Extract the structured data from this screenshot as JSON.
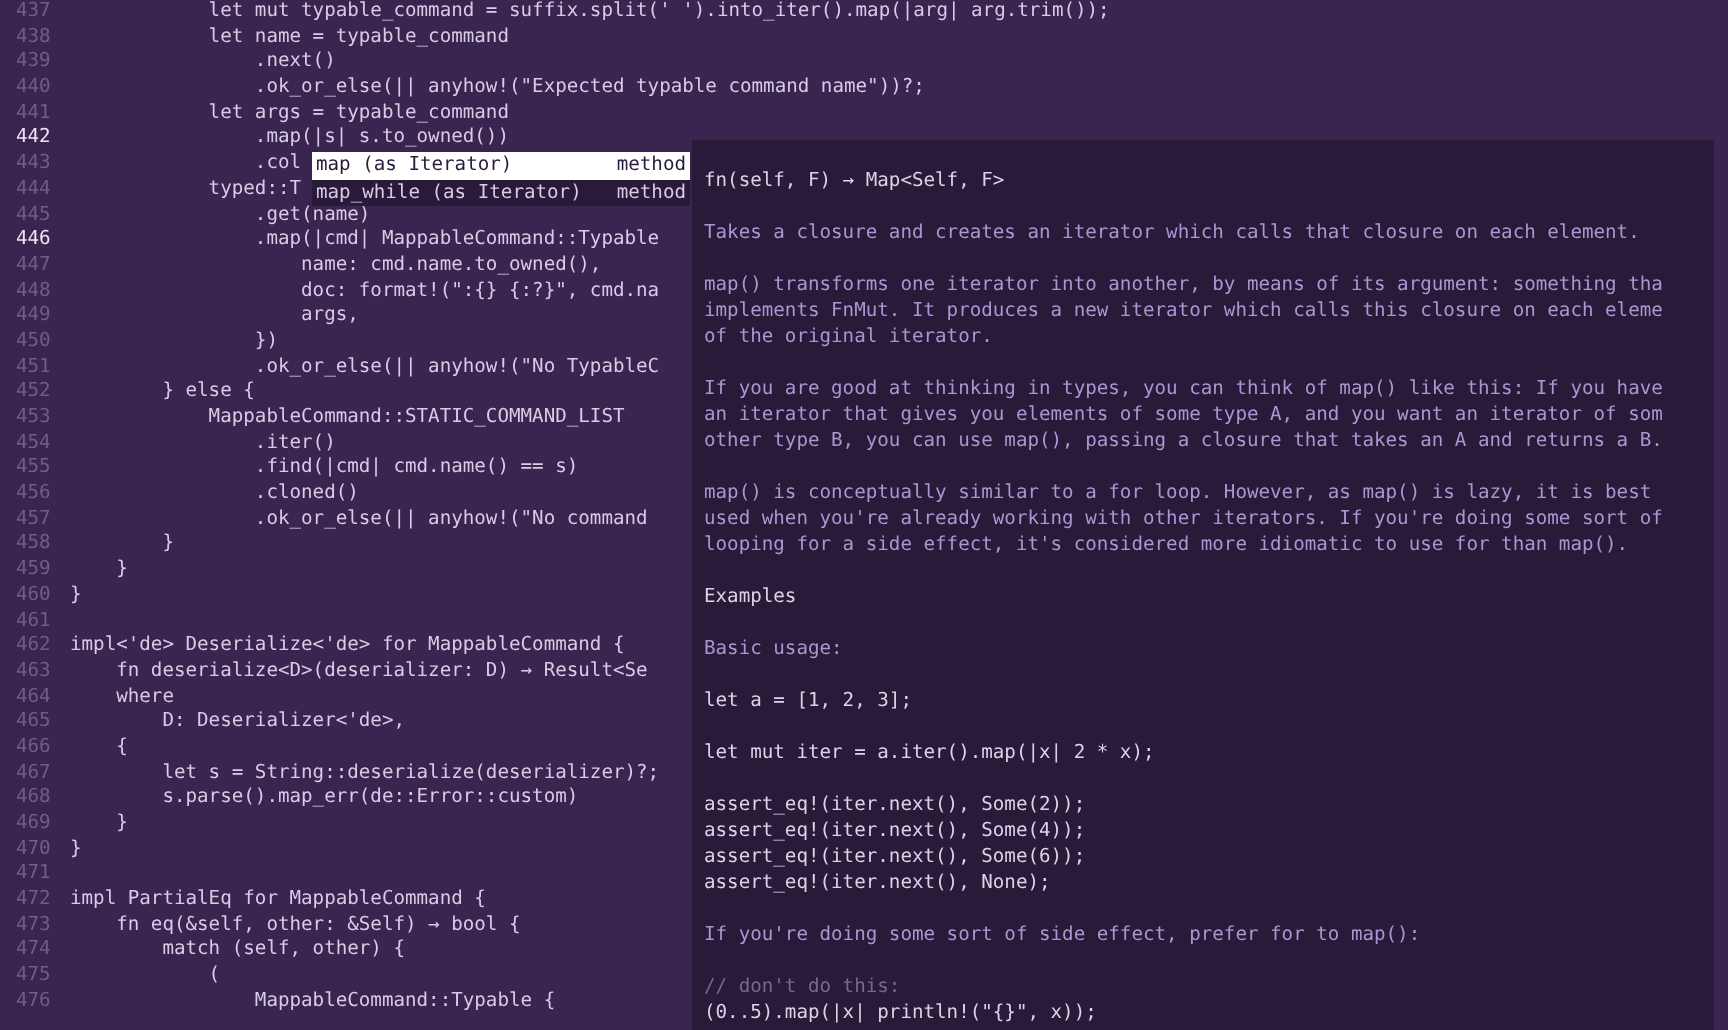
{
  "editor": {
    "lines": [
      {
        "number": "437",
        "code": "            let mut typable_command = suffix.split(' ').into_iter().map(|arg| arg.trim());",
        "current": false
      },
      {
        "number": "438",
        "code": "            let name = typable_command",
        "current": false
      },
      {
        "number": "439",
        "code": "                .next()",
        "current": false
      },
      {
        "number": "440",
        "code": "                .ok_or_else(|| anyhow!(\"Expected typable command name\"))?;",
        "current": false
      },
      {
        "number": "441",
        "code": "            let args = typable_command",
        "current": false
      },
      {
        "number": "442",
        "code": "                .map(|s| s.to_owned())",
        "current": true
      },
      {
        "number": "443",
        "code": "                .col",
        "current": false
      },
      {
        "number": "444",
        "code": "            typed::T",
        "current": false
      },
      {
        "number": "445",
        "code": "                .get(name)",
        "current": false
      },
      {
        "number": "446",
        "code": "                .map(|cmd| MappableCommand::Typable",
        "current": true
      },
      {
        "number": "447",
        "code": "                    name: cmd.name.to_owned(),",
        "current": false
      },
      {
        "number": "448",
        "code": "                    doc: format!(\":{} {:?}\", cmd.na",
        "current": false
      },
      {
        "number": "449",
        "code": "                    args,",
        "current": false
      },
      {
        "number": "450",
        "code": "                })",
        "current": false
      },
      {
        "number": "451",
        "code": "                .ok_or_else(|| anyhow!(\"No TypableC",
        "current": false
      },
      {
        "number": "452",
        "code": "        } else {",
        "current": false
      },
      {
        "number": "453",
        "code": "            MappableCommand::STATIC_COMMAND_LIST",
        "current": false
      },
      {
        "number": "454",
        "code": "                .iter()",
        "current": false
      },
      {
        "number": "455",
        "code": "                .find(|cmd| cmd.name() == s)",
        "current": false
      },
      {
        "number": "456",
        "code": "                .cloned()",
        "current": false
      },
      {
        "number": "457",
        "code": "                .ok_or_else(|| anyhow!(\"No command",
        "current": false
      },
      {
        "number": "458",
        "code": "        }",
        "current": false
      },
      {
        "number": "459",
        "code": "    }",
        "current": false
      },
      {
        "number": "460",
        "code": "}",
        "current": false
      },
      {
        "number": "461",
        "current": false
      },
      {
        "number": "462",
        "code": "impl<'de> Deserialize<'de> for MappableCommand {",
        "current": false
      },
      {
        "number": "463",
        "code": "    fn deserialize<D>(deserializer: D) → Result<Se",
        "current": false
      },
      {
        "number": "464",
        "code": "    where",
        "current": false
      },
      {
        "number": "465",
        "code": "        D: Deserializer<'de>,",
        "current": false
      },
      {
        "number": "466",
        "code": "    {",
        "current": false
      },
      {
        "number": "467",
        "code": "        let s = String::deserialize(deserializer)?;",
        "current": false
      },
      {
        "number": "468",
        "code": "        s.parse().map_err(de::Error::custom)",
        "current": false
      },
      {
        "number": "469",
        "code": "    }",
        "current": false
      },
      {
        "number": "470",
        "code": "}",
        "current": false
      },
      {
        "number": "471",
        "current": false
      },
      {
        "number": "472",
        "code": "impl PartialEq for MappableCommand {",
        "current": false
      },
      {
        "number": "473",
        "code": "    fn eq(&self, other: &Self) → bool {",
        "current": false
      },
      {
        "number": "474",
        "code": "        match (self, other) {",
        "current": false
      },
      {
        "number": "475",
        "code": "            (",
        "current": false
      },
      {
        "number": "476",
        "code": "                MappableCommand::Typable {",
        "current": false
      }
    ]
  },
  "completion": {
    "items": [
      {
        "label": "map (as Iterator)",
        "detail": "method",
        "selected": true
      },
      {
        "label": "map_while (as Iterator)",
        "detail": "method",
        "selected": false
      }
    ]
  },
  "documentation": {
    "blocks": [
      {
        "lines": [
          {
            "kind": "code",
            "text": "fn(self, F) → Map<Self, F>"
          }
        ]
      },
      {
        "lines": [
          {
            "kind": "prose",
            "text": "Takes a closure and creates an iterator which calls that closure on each element."
          }
        ]
      },
      {
        "lines": [
          {
            "kind": "prose",
            "text": "map() transforms one iterator into another, by means of its argument: something tha"
          },
          {
            "kind": "prose",
            "text": "implements FnMut. It produces a new iterator which calls this closure on each eleme"
          },
          {
            "kind": "prose",
            "text": "of the original iterator."
          }
        ]
      },
      {
        "lines": [
          {
            "kind": "prose",
            "text": "If you are good at thinking in types, you can think of map() like this: If you have"
          },
          {
            "kind": "prose",
            "text": "an iterator that gives you elements of some type A, and you want an iterator of som"
          },
          {
            "kind": "prose",
            "text": "other type B, you can use map(), passing a closure that takes an A and returns a B."
          }
        ]
      },
      {
        "lines": [
          {
            "kind": "prose",
            "text": "map() is conceptually similar to a for loop. However, as map() is lazy, it is best"
          },
          {
            "kind": "prose",
            "text": "used when you're already working with other iterators. If you're doing some sort of"
          },
          {
            "kind": "prose",
            "text": "looping for a side effect, it's considered more idiomatic to use for than map()."
          }
        ]
      },
      {
        "lines": [
          {
            "kind": "heading",
            "text": "Examples"
          }
        ]
      },
      {
        "lines": [
          {
            "kind": "prose",
            "text": "Basic usage:"
          }
        ]
      },
      {
        "lines": [
          {
            "kind": "code",
            "text": "let a = [1, 2, 3];"
          }
        ]
      },
      {
        "lines": [
          {
            "kind": "code",
            "text": "let mut iter = a.iter().map(|x| 2 * x);"
          }
        ]
      },
      {
        "lines": [
          {
            "kind": "code",
            "text": "assert_eq!(iter.next(), Some(2));"
          },
          {
            "kind": "code",
            "text": "assert_eq!(iter.next(), Some(4));"
          },
          {
            "kind": "code",
            "text": "assert_eq!(iter.next(), Some(6));"
          },
          {
            "kind": "code",
            "text": "assert_eq!(iter.next(), None);"
          }
        ]
      },
      {
        "lines": [
          {
            "kind": "prose",
            "text": "If you're doing some sort of side effect, prefer for to map():"
          }
        ]
      },
      {
        "lines": [
          {
            "kind": "comment",
            "text": "// don't do this:"
          },
          {
            "kind": "code",
            "text": "(0..5).map(|x| println!(\"{}\", x));"
          }
        ]
      }
    ]
  }
}
